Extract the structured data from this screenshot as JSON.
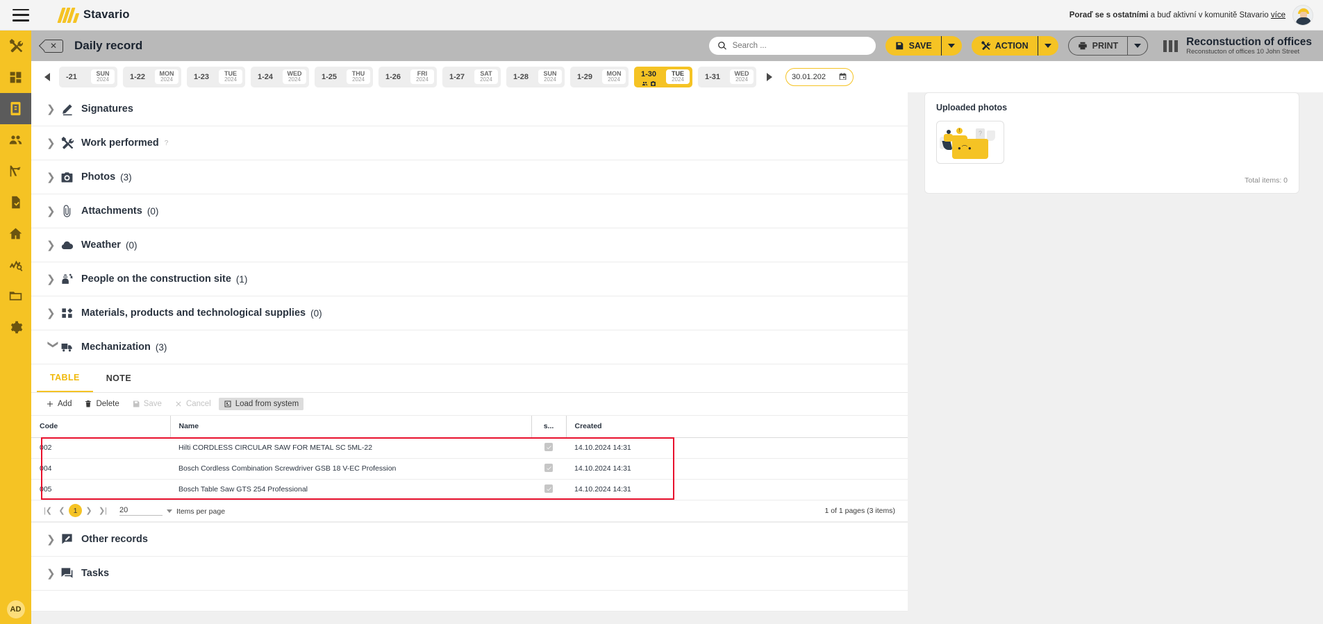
{
  "topbar": {
    "menu_icon": "hamburger-icon",
    "brand": "Stavario",
    "promo_bold": "Poraď se s ostatními",
    "promo_rest": " a buď aktivní v komunitě Stavario ",
    "promo_link": "více"
  },
  "rail": {
    "items": [
      {
        "name": "tools",
        "icon": "tools-icon",
        "active": false
      },
      {
        "name": "dashboard",
        "icon": "grid-icon",
        "active": false
      },
      {
        "name": "daily-record",
        "icon": "daily-record-icon",
        "active": true
      },
      {
        "name": "people",
        "icon": "people-icon",
        "active": false
      },
      {
        "name": "crane",
        "icon": "crane-icon",
        "active": false
      },
      {
        "name": "approvals",
        "icon": "document-check-icon",
        "active": false
      },
      {
        "name": "home",
        "icon": "home-icon",
        "active": false
      },
      {
        "name": "analytics",
        "icon": "analytics-search-icon",
        "active": false
      },
      {
        "name": "folder",
        "icon": "folder-icon",
        "active": false
      },
      {
        "name": "settings",
        "icon": "gear-icon",
        "active": false
      }
    ],
    "badge": "AD"
  },
  "subheader": {
    "page_title": "Daily record",
    "search_placeholder": "Search ...",
    "save_label": "SAVE",
    "action_label": "ACTION",
    "print_label": "PRINT",
    "project_title": "Reconstuction of offices",
    "project_subtitle": "Reconstucton of offices 10 John Street"
  },
  "datestrip": {
    "days": [
      {
        "num": "-21",
        "dow": "SUN",
        "year": "2024",
        "selected": false
      },
      {
        "num": "1-22",
        "dow": "MON",
        "year": "2024",
        "selected": false
      },
      {
        "num": "1-23",
        "dow": "TUE",
        "year": "2024",
        "selected": false
      },
      {
        "num": "1-24",
        "dow": "WED",
        "year": "2024",
        "selected": false
      },
      {
        "num": "1-25",
        "dow": "THU",
        "year": "2024",
        "selected": false
      },
      {
        "num": "1-26",
        "dow": "FRI",
        "year": "2024",
        "selected": false
      },
      {
        "num": "1-27",
        "dow": "SAT",
        "year": "2024",
        "selected": false
      },
      {
        "num": "1-28",
        "dow": "SUN",
        "year": "2024",
        "selected": false
      },
      {
        "num": "1-29",
        "dow": "MON",
        "year": "2024",
        "selected": false
      },
      {
        "num": "1-30",
        "dow": "TUE",
        "year": "2024",
        "selected": true
      },
      {
        "num": "1-31",
        "dow": "WED",
        "year": "2024",
        "selected": false
      }
    ],
    "date_value": "30.01.202"
  },
  "sections": [
    {
      "label": "Signatures",
      "count": "",
      "icon": "signature-pen-icon",
      "help": false,
      "expanded": false
    },
    {
      "label": "Work performed",
      "count": "",
      "icon": "tools-icon",
      "help": true,
      "expanded": false
    },
    {
      "label": "Photos",
      "count": "(3)",
      "icon": "camera-icon",
      "help": false,
      "expanded": false
    },
    {
      "label": "Attachments",
      "count": "(0)",
      "icon": "paperclip-icon",
      "help": false,
      "expanded": false
    },
    {
      "label": "Weather",
      "count": "(0)",
      "icon": "cloud-icon",
      "help": false,
      "expanded": false
    },
    {
      "label": "People on the construction site",
      "count": "(1)",
      "icon": "worker-people-icon",
      "help": false,
      "expanded": false
    },
    {
      "label": "Materials, products and technological supplies",
      "count": "(0)",
      "icon": "materials-icon",
      "help": false,
      "expanded": false
    },
    {
      "label": "Mechanization",
      "count": "(3)",
      "icon": "truck-icon",
      "help": false,
      "expanded": true
    }
  ],
  "bottom_sections": [
    {
      "label": "Other records",
      "count": "",
      "icon": "note-edit-icon"
    },
    {
      "label": "Tasks",
      "count": "",
      "icon": "chat-tasks-icon"
    }
  ],
  "mechanization": {
    "tabs": [
      {
        "label": "TABLE",
        "active": true
      },
      {
        "label": "NOTE",
        "active": false
      }
    ],
    "toolbar": [
      {
        "label": "Add",
        "icon": "plus-icon",
        "state": "enabled"
      },
      {
        "label": "Delete",
        "icon": "trash-icon",
        "state": "enabled"
      },
      {
        "label": "Save",
        "icon": "save-icon",
        "state": "disabled"
      },
      {
        "label": "Cancel",
        "icon": "cancel-icon",
        "state": "disabled"
      },
      {
        "label": "Load from system",
        "icon": "import-icon",
        "state": "highlighted"
      }
    ],
    "columns": [
      "Code",
      "Name",
      "s...",
      "Created"
    ],
    "rows": [
      {
        "code": "002",
        "name": "Hilti CORDLESS CIRCULAR SAW FOR METAL SC 5ML-22",
        "checked": true,
        "created": "14.10.2024 14:31"
      },
      {
        "code": "004",
        "name": "Bosch Cordless Combination Screwdriver GSB 18 V-EC Profession",
        "checked": true,
        "created": "14.10.2024 14:31"
      },
      {
        "code": "005",
        "name": "Bosch Table Saw GTS 254 Professional",
        "checked": true,
        "created": "14.10.2024 14:31"
      }
    ],
    "pager": {
      "current_page": "1",
      "per_page": "20",
      "per_page_label": "Items per page",
      "info": "1 of 1 pages (3 items)"
    }
  },
  "uploaded_photos": {
    "title": "Uploaded photos",
    "total_label": "Total items: 0"
  },
  "colors": {
    "accent": "#f5c324",
    "dark": "#2b3440",
    "highlight_box": "#e8112d"
  }
}
